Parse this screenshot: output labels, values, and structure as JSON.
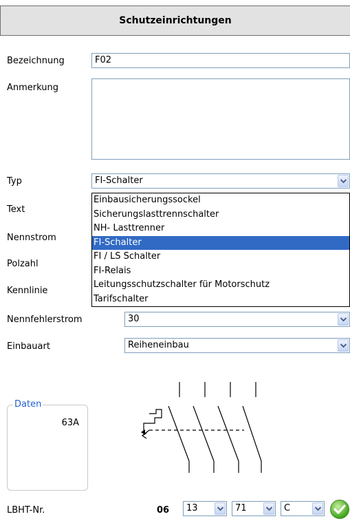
{
  "header": {
    "title": "Schutzeinrichtungen"
  },
  "form": {
    "bezeichnung": {
      "label": "Bezeichnung",
      "value": "F02"
    },
    "anmerkung": {
      "label": "Anmerkung",
      "value": ""
    },
    "typ": {
      "label": "Typ",
      "value": "FI-Schalter"
    },
    "text": {
      "label": "Text"
    },
    "nennstrom": {
      "label": "Nennstrom"
    },
    "polzahl": {
      "label": "Polzahl"
    },
    "kennlinie": {
      "label": "Kennlinie"
    },
    "nennfehlerstrom": {
      "label": "Nennfehlerstrom",
      "value": "30"
    },
    "einbauart": {
      "label": "Einbauart",
      "value": "Reiheneinbau"
    }
  },
  "typ_dropdown": {
    "options": [
      "Einbausicherungssockel",
      "Sicherungslasttrennschalter",
      "NH- Lasttrenner",
      "FI-Schalter",
      "FI / LS Schalter",
      "FI-Relais",
      "Leitungsschutzschalter für Motorschutz",
      "Tarifschalter"
    ],
    "selected_index": 3
  },
  "daten": {
    "title": "Daten",
    "value": "63A"
  },
  "lbht": {
    "label": "LBHT-Nr.",
    "prefix": "06",
    "sel1": "13",
    "sel2": "71",
    "sel3": "C"
  },
  "colors": {
    "header_bg": "#e2e2e2",
    "selection": "#316ac5",
    "group_title": "#2060d0",
    "ok_green": "#3fa51a"
  },
  "icons": [
    "chevron-down-icon",
    "check-icon",
    "fi-schalter-symbol"
  ]
}
